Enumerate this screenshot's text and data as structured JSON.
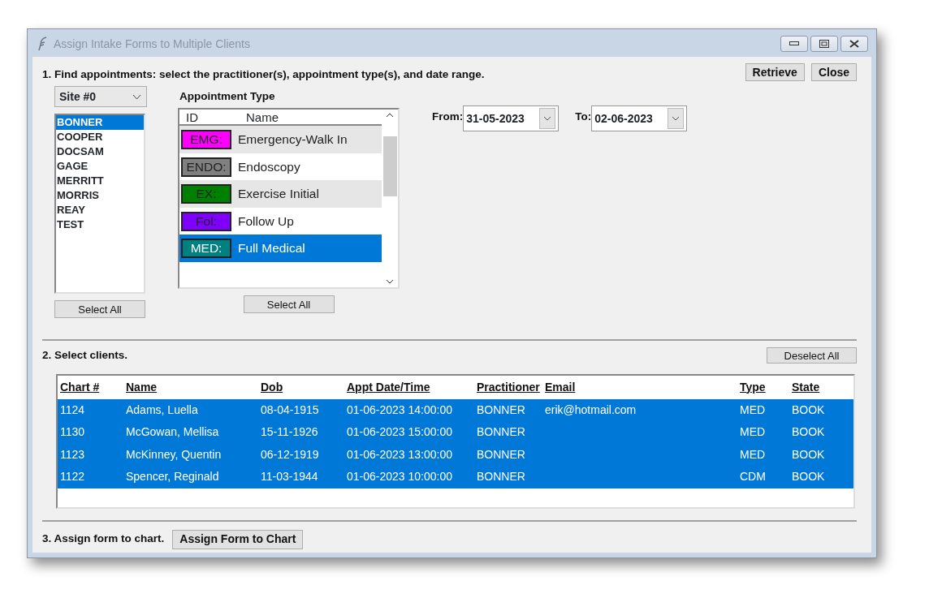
{
  "window": {
    "title": "Assign Intake Forms to Multiple Clients"
  },
  "find": {
    "heading": "1. Find appointments: select the practitioner(s), appointment type(s), and date range.",
    "retrieve_button": "Retrieve",
    "close_button": "Close",
    "site": {
      "value": "Site #0"
    },
    "practitioners": [
      {
        "name": "BONNER",
        "selected": true
      },
      {
        "name": "COOPER",
        "selected": false
      },
      {
        "name": "DOCSAM",
        "selected": false
      },
      {
        "name": "GAGE",
        "selected": false
      },
      {
        "name": "MERRITT",
        "selected": false
      },
      {
        "name": "MORRIS",
        "selected": false
      },
      {
        "name": "REAY",
        "selected": false
      },
      {
        "name": "TEST",
        "selected": false
      }
    ],
    "practitioners_select_all": "Select All",
    "appointment_type_label": "Appointment Type",
    "appointment_type_columns": [
      "ID",
      "Name"
    ],
    "appointment_types": [
      {
        "id": "EMG:",
        "name": "Emergency-Walk In",
        "color": "#ff00ff",
        "selected": false
      },
      {
        "id": "ENDO:",
        "name": "Endoscopy",
        "color": "#808080",
        "selected": false
      },
      {
        "id": "EX:",
        "name": "Exercise Initial",
        "color": "#008000",
        "selected": false
      },
      {
        "id": "Fol:",
        "name": "Follow Up",
        "color": "#8000ff",
        "selected": false
      },
      {
        "id": "MED:",
        "name": "Full Medical",
        "color": "#008080",
        "selected": true
      }
    ],
    "types_select_all": "Select All",
    "from": {
      "label": "From:",
      "value": "31-05-2023"
    },
    "to": {
      "label": "To:",
      "value": "02-06-2023"
    }
  },
  "clients": {
    "heading": "2. Select clients.",
    "deselect_button": "Deselect All",
    "table": {
      "columns": [
        "Chart #",
        "Name",
        "Dob",
        "Appt Date/Time",
        "Practitioner",
        "Email",
        "Type",
        "State"
      ],
      "rows": [
        {
          "selected": true,
          "cells": [
            "1124",
            "Adams, Luella",
            "08-04-1915",
            "01-06-2023 14:00:00",
            "BONNER",
            "erik@hotmail.com",
            "MED",
            "BOOK"
          ]
        },
        {
          "selected": true,
          "cells": [
            "1130",
            "McGowan, Mellisa",
            "15-11-1926",
            "01-06-2023 15:00:00",
            "BONNER",
            "",
            "MED",
            "BOOK"
          ]
        },
        {
          "selected": true,
          "cells": [
            "1123",
            "McKinney, Quentin",
            "06-12-1919",
            "01-06-2023 13:00:00",
            "BONNER",
            "",
            "MED",
            "BOOK"
          ]
        },
        {
          "selected": true,
          "cells": [
            "1122",
            "Spencer, Reginald",
            "11-03-1944",
            "01-06-2023 10:00:00",
            "BONNER",
            "",
            "CDM",
            "BOOK"
          ]
        }
      ]
    }
  },
  "assign": {
    "heading": "3. Assign form to chart.",
    "button": "Assign Form to Chart"
  }
}
